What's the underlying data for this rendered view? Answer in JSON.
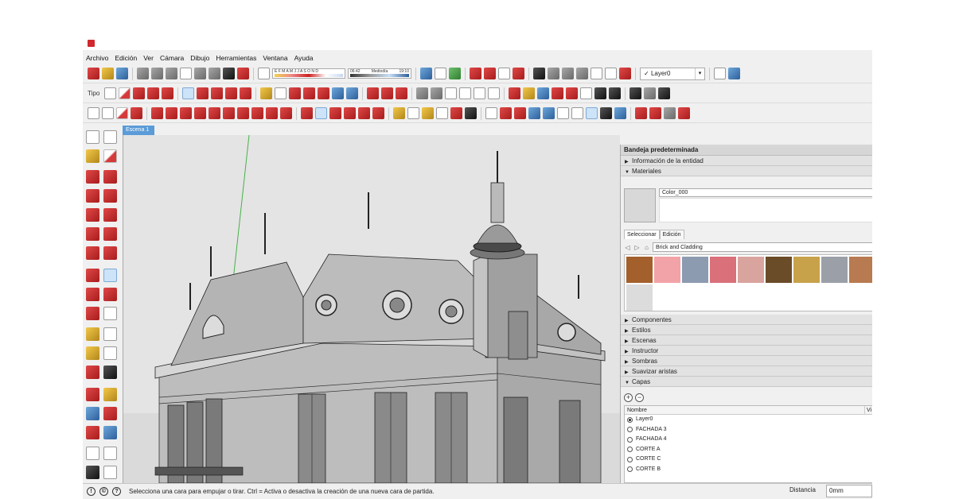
{
  "window": {
    "app_name": "SketchUp"
  },
  "menu": {
    "items": [
      "Archivo",
      "Edición",
      "Ver",
      "Cámara",
      "Dibujo",
      "Herramientas",
      "Ventana",
      "Ayuda"
    ]
  },
  "toolbar": {
    "shadow_months": "E F M A M J J A S O N D",
    "time_left": "06:42",
    "time_mid": "Mediodía",
    "time_right": "19:10",
    "layer_value": "Layer0",
    "layer_check": "✓",
    "tipo_label": "Tipo"
  },
  "scene": {
    "tab_label": "Escena 1"
  },
  "tray": {
    "title": "Bandeja predeterminada",
    "entity_info": "Información de la entidad",
    "materials": "Materiales",
    "material_name": "Color_000",
    "tab_select": "Seleccionar",
    "tab_edit": "Edición",
    "library": "Brick and Cladding",
    "sections": [
      "Componentes",
      "Estilos",
      "Escenas",
      "Instructor",
      "Sombras",
      "Suavizar aristas"
    ],
    "layers": "Capas",
    "layer_col_name": "Nombre",
    "layer_col_visible": "Vi",
    "layers_list": [
      "Layer0",
      "FACHADA 3",
      "FACHADA 4",
      "CORTE A",
      "CORTE C",
      "CORTE B"
    ],
    "active_layer": "Layer0"
  },
  "swatch_colors": [
    "#a3602c",
    "#f2a3a8",
    "#8c9bb0",
    "#d9707a",
    "#d9a49e",
    "#6a4c28",
    "#c8a24a",
    "#9ba0a8",
    "#b87a50",
    "#dcdcdc"
  ],
  "status": {
    "message": "Selecciona una cara para empujar o tirar. Ctrl = Activa o desactiva la creación de una nueva cara de partida.",
    "distance_label": "Distancia",
    "distance_value": "0mm"
  }
}
